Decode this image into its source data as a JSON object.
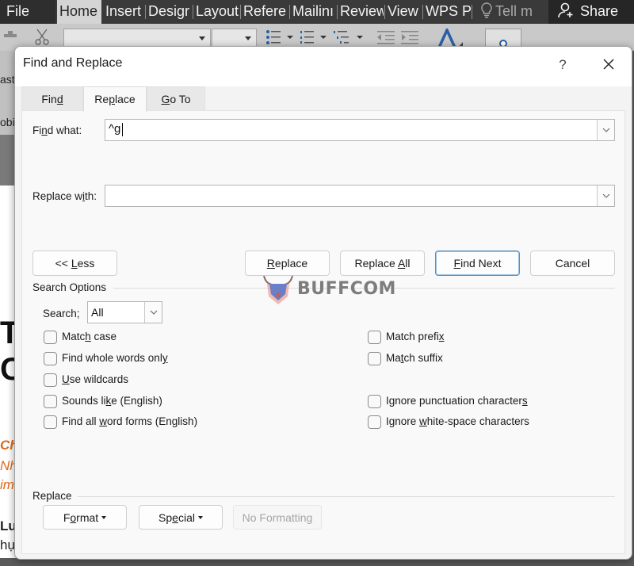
{
  "app": {
    "ribbon_tabs": [
      {
        "label": "File"
      },
      {
        "label": "Home"
      },
      {
        "label": "Insert"
      },
      {
        "label": "Desigr"
      },
      {
        "label": "Layout"
      },
      {
        "label": "Refere"
      },
      {
        "label": "Mailinı"
      },
      {
        "label": "Review"
      },
      {
        "label": "View"
      },
      {
        "label": "WPS P"
      }
    ],
    "tell_me": "Tell m",
    "share": "Share",
    "left_fragments": [
      "ast",
      "obi"
    ],
    "doc_fragments": [
      {
        "text": "T"
      },
      {
        "text": "C"
      },
      {
        "text": "Ch"
      },
      {
        "text": "Nh"
      },
      {
        "text": "im"
      },
      {
        "text": "Lu"
      },
      {
        "text": "hụ"
      }
    ],
    "doc_accent_color": "#e06a1b"
  },
  "dialog": {
    "title": "Find and Replace",
    "help": "?",
    "tabs": [
      {
        "pre": "Fin",
        "u": "d",
        "post": "",
        "active": false
      },
      {
        "pre": "Re",
        "u": "p",
        "post": "lace",
        "active": true
      },
      {
        "pre": "",
        "u": "G",
        "post": "o To",
        "active": false
      }
    ],
    "find_what": {
      "label_pre": "Fi",
      "label_u": "n",
      "label_post": "d what:",
      "value": "^g"
    },
    "replace_with": {
      "label_pre": "Replace w",
      "label_u": "i",
      "label_post": "th:",
      "value": ""
    },
    "buttons": {
      "less": {
        "pre": "<< ",
        "u": "L",
        "post": "ess"
      },
      "replace": {
        "pre": "",
        "u": "R",
        "post": "eplace"
      },
      "replace_all": {
        "pre": "Replace ",
        "u": "A",
        "post": "ll"
      },
      "find_next": {
        "pre": "",
        "u": "F",
        "post": "ind Next"
      },
      "cancel": "Cancel"
    },
    "search_options": {
      "title": "Search Options",
      "search_label_pre": "Search",
      "search_label_u": ";",
      "search_value": "All",
      "left_checkboxes": [
        {
          "pre": "Matc",
          "u": "h",
          "post": " case",
          "checked": false
        },
        {
          "pre": "Find whole words onl",
          "u": "y",
          "post": "",
          "checked": false
        },
        {
          "pre": "",
          "u": "U",
          "post": "se wildcards",
          "checked": false
        },
        {
          "pre": "Sounds li",
          "u": "k",
          "post": "e (English)",
          "checked": false
        },
        {
          "pre": "Find all ",
          "u": "w",
          "post": "ord forms (English)",
          "checked": false
        }
      ],
      "right_checkboxes": [
        {
          "pre": "Match prefi",
          "u": "x",
          "post": "",
          "checked": false
        },
        {
          "pre": "Ma",
          "u": "t",
          "post": "ch suffix",
          "checked": false
        },
        {
          "pre": "Ignore punctuation character",
          "u": "s",
          "post": "",
          "checked": false
        },
        {
          "pre": "Ignore ",
          "u": "w",
          "post": "hite-space characters",
          "checked": false
        }
      ]
    },
    "replace_group": {
      "title": "Replace",
      "format": {
        "pre": "F",
        "u": "o",
        "post": "rmat"
      },
      "special": {
        "pre": "Sp",
        "u": "e",
        "post": "cial"
      },
      "no_formatting": "No Formatting"
    }
  },
  "watermark": {
    "text": "BUFFCOM"
  }
}
